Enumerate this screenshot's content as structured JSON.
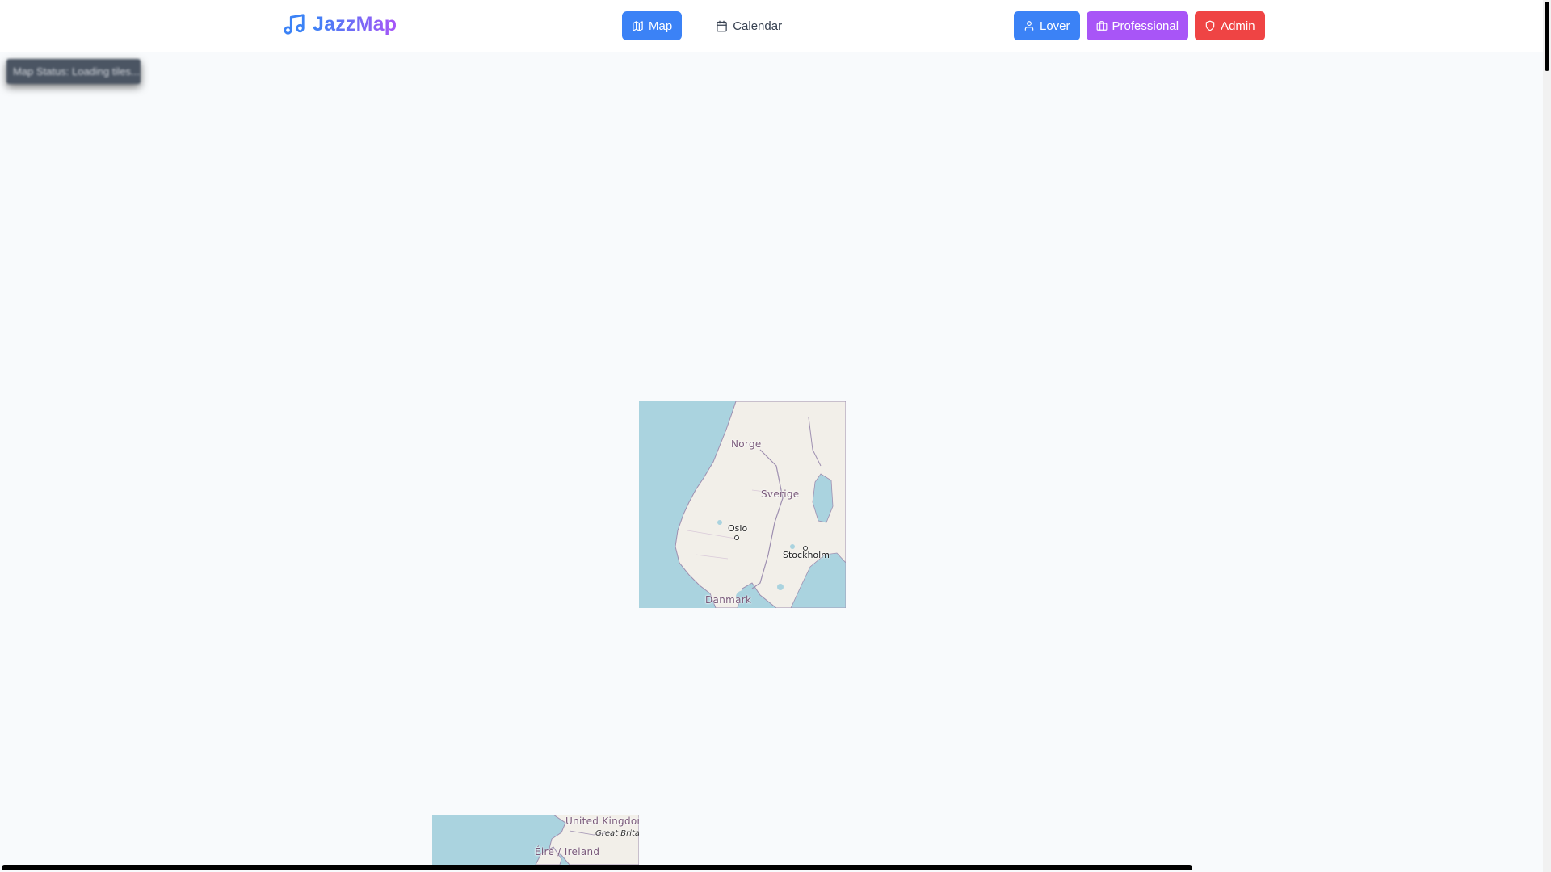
{
  "header": {
    "logo_text": "JazzMap",
    "logo_icon": "music-note-icon",
    "nav": [
      {
        "label": "Map",
        "icon": "map-icon",
        "active": true
      },
      {
        "label": "Calendar",
        "icon": "calendar-icon",
        "active": false
      }
    ],
    "roles": [
      {
        "label": "Lover",
        "icon": "user-icon",
        "color": "#3b82f6"
      },
      {
        "label": "Professional",
        "icon": "briefcase-icon",
        "color": "#a855f7"
      },
      {
        "label": "Admin",
        "icon": "shield-icon",
        "color": "#ef4444"
      }
    ]
  },
  "status": {
    "text": "Map Status: Loading tiles..."
  },
  "map": {
    "tile_scandinavia": {
      "labels": {
        "norway": "Norge",
        "sweden": "Sverige",
        "oslo": "Oslo",
        "stockholm": "Stockholm",
        "denmark": "Danmark"
      }
    },
    "tile_uk": {
      "labels": {
        "uk": "United Kingdom",
        "great_britain": "Great Britain",
        "ireland": "Éire / Ireland"
      }
    },
    "colors": {
      "water": "#aad3df",
      "land": "#f2efe9",
      "border": "#9e8fb0"
    }
  }
}
